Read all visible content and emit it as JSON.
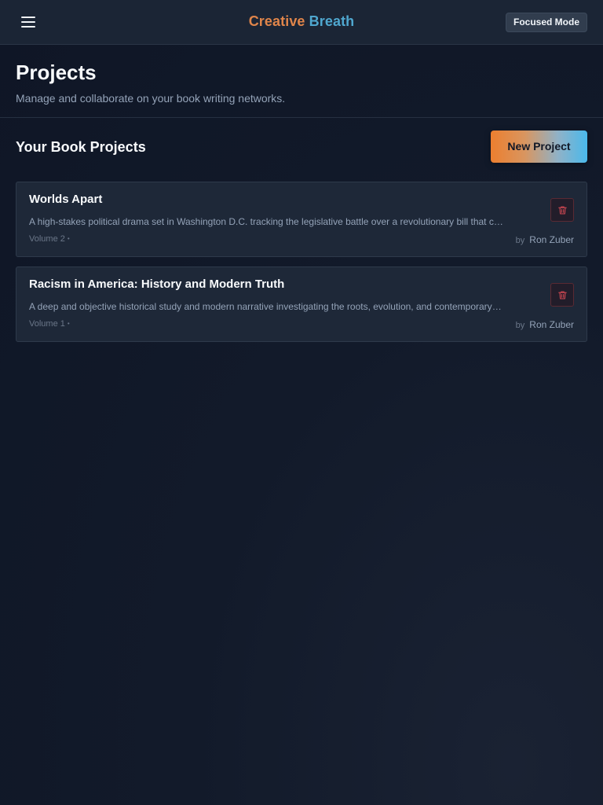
{
  "app": {
    "brand_part1": "Creative",
    "brand_part2": "Breath",
    "focused_mode_label": "Focused Mode"
  },
  "header": {
    "title": "Projects",
    "subtitle": "Manage and collaborate on your book writing networks."
  },
  "section": {
    "title": "Your Book Projects",
    "new_project_label": "New Project"
  },
  "projects": [
    {
      "title": "Worlds Apart",
      "description": "A high-stakes political drama set in Washington D.C. tracking the legislative battle over a revolutionary bill that could reshape the nation",
      "volume": "Volume 2",
      "by_label": "by",
      "author": "Ron Zuber"
    },
    {
      "title": "Racism in America: History and Modern Truth",
      "description": "A deep and objective historical study and modern narrative investigating the roots, evolution, and contemporary impact of racism in America",
      "volume": "Volume 1",
      "by_label": "by",
      "author": "Ron Zuber"
    }
  ],
  "icons": {
    "menu": "hamburger-menu-icon",
    "delete": "trash-icon"
  },
  "colors": {
    "brand_orange": "#e0854a",
    "brand_blue": "#4fa7cf",
    "delete_red": "#c0444f"
  }
}
